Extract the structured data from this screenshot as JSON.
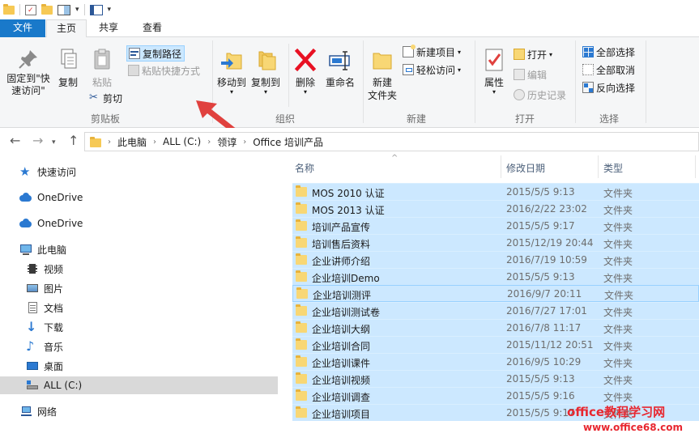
{
  "ribbon_tabs": {
    "file": "文件",
    "home": "主页",
    "share": "共享",
    "view": "查看"
  },
  "clipboard": {
    "pin": "固定到\"快\n速访问\"",
    "copy": "复制",
    "paste": "粘贴",
    "copy_path": "复制路径",
    "paste_shortcut": "粘贴快捷方式",
    "cut": "剪切",
    "label": "剪贴板"
  },
  "organize": {
    "move_to": "移动到",
    "copy_to": "复制到",
    "delete": "删除",
    "rename": "重命名",
    "label": "组织"
  },
  "new": {
    "new_folder": "新建\n文件夹",
    "new_item": "新建项目",
    "easy_access": "轻松访问",
    "label": "新建"
  },
  "open": {
    "properties": "属性",
    "open": "打开",
    "edit": "编辑",
    "history": "历史记录",
    "label": "打开"
  },
  "select": {
    "select_all": "全部选择",
    "select_none": "全部取消",
    "invert": "反向选择",
    "label": "选择"
  },
  "address": {
    "crumbs": [
      "此电脑",
      "ALL (C:)",
      "领谆",
      "Office 培训产品"
    ]
  },
  "nav_pane": {
    "items": [
      {
        "label": "快速访问",
        "icon": "star-icon"
      },
      {
        "label": "OneDrive",
        "icon": "cloud-icon"
      },
      {
        "label": "OneDrive",
        "icon": "cloud-icon"
      },
      {
        "label": "此电脑",
        "icon": "computer-icon"
      },
      {
        "label": "视频",
        "icon": "video-icon"
      },
      {
        "label": "图片",
        "icon": "picture-icon"
      },
      {
        "label": "文档",
        "icon": "document-icon"
      },
      {
        "label": "下载",
        "icon": "download-icon"
      },
      {
        "label": "音乐",
        "icon": "music-icon"
      },
      {
        "label": "桌面",
        "icon": "desktop-icon"
      },
      {
        "label": "ALL (C:)",
        "icon": "drive-icon"
      },
      {
        "label": "网络",
        "icon": "network-icon"
      }
    ]
  },
  "file_list": {
    "columns": {
      "name": "名称",
      "date": "修改日期",
      "type": "类型"
    },
    "rows": [
      {
        "name": "MOS 2010 认证",
        "date": "2015/5/5 9:13",
        "type": "文件夹"
      },
      {
        "name": "MOS 2013 认证",
        "date": "2016/2/22 23:02",
        "type": "文件夹"
      },
      {
        "name": "培训产品宣传",
        "date": "2015/5/5 9:17",
        "type": "文件夹"
      },
      {
        "name": "培训售后资料",
        "date": "2015/12/19 20:44",
        "type": "文件夹"
      },
      {
        "name": "企业讲师介绍",
        "date": "2016/7/19 10:59",
        "type": "文件夹"
      },
      {
        "name": "企业培训Demo",
        "date": "2015/5/5 9:13",
        "type": "文件夹"
      },
      {
        "name": "企业培训测评",
        "date": "2016/9/7 20:11",
        "type": "文件夹"
      },
      {
        "name": "企业培训测试卷",
        "date": "2016/7/27 17:01",
        "type": "文件夹"
      },
      {
        "name": "企业培训大纲",
        "date": "2016/7/8 11:17",
        "type": "文件夹"
      },
      {
        "name": "企业培训合同",
        "date": "2015/11/12 20:51",
        "type": "文件夹"
      },
      {
        "name": "企业培训课件",
        "date": "2016/9/5 10:29",
        "type": "文件夹"
      },
      {
        "name": "企业培训视频",
        "date": "2015/5/5 9:13",
        "type": "文件夹"
      },
      {
        "name": "企业培训调查",
        "date": "2015/5/5 9:16",
        "type": "文件夹"
      },
      {
        "name": "企业培训项目",
        "date": "2015/5/5 9:17",
        "type": "文件夹"
      }
    ]
  },
  "watermark": {
    "line1": "office教程学习网",
    "line2": "www.office68.com"
  },
  "colors": {
    "accent": "#1979ca",
    "selection": "#cce8ff",
    "arrow": "#e0413e",
    "folder": "#f8d775"
  }
}
